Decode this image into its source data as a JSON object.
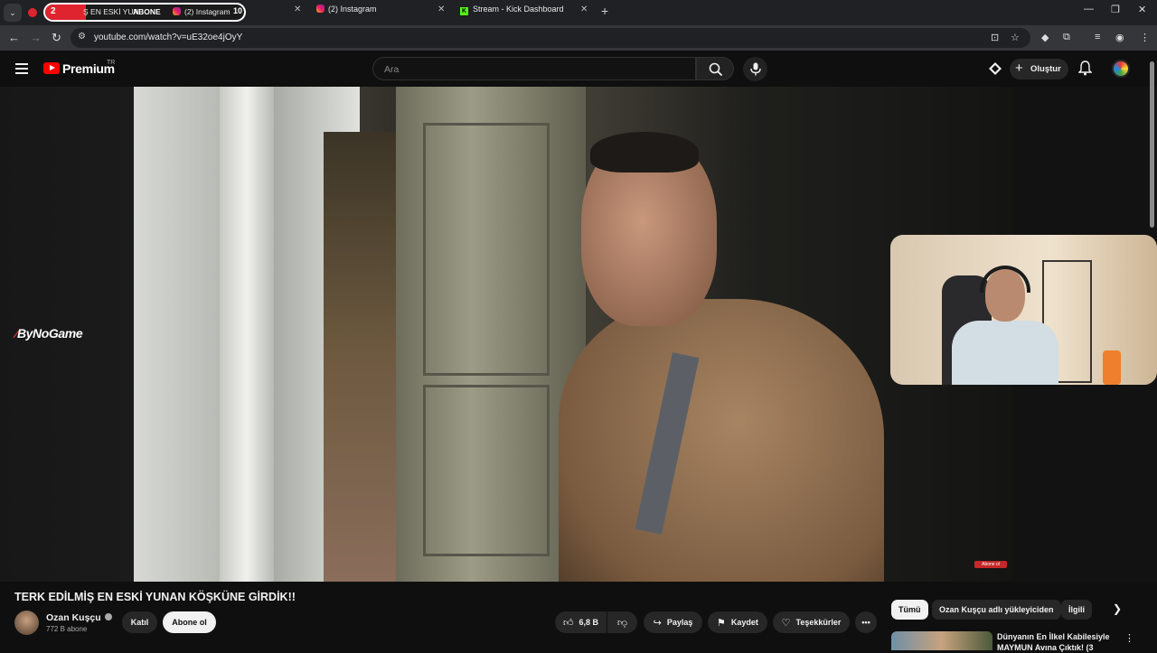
{
  "browser": {
    "tab_group_count": "2",
    "tab_group_title": "Ş EN ESKİ YUN",
    "tab_group_label": "ABONE",
    "tab_group_inst": "(2) Instagram",
    "tab_group_badge": "10",
    "tabs": [
      {
        "title": "(2) Instagram",
        "icon": "instagram-icon"
      },
      {
        "title": "Stream - Kick Dashboard",
        "icon": "kick-icon"
      }
    ],
    "url": "youtube.com/watch?v=uE32oe4jOyY"
  },
  "masthead": {
    "brand": "Premium",
    "country": "TR",
    "search_placeholder": "Ara",
    "create_label": "Oluştur"
  },
  "player": {
    "watermark": "ByNoGame",
    "endcard": "Abone ol"
  },
  "video": {
    "title": "TERK EDİLMİŞ EN ESKİ YUNAN KÖŞKÜNE GİRDİK!!",
    "channel": "Ozan Kuşçu",
    "subscribers": "772 B abone",
    "join_label": "Katıl",
    "subscribe_label": "Abone ol",
    "likes": "6,8 B",
    "share_label": "Paylaş",
    "save_label": "Kaydet",
    "thanks_label": "Teşekkürler"
  },
  "sidebar": {
    "chips": [
      "Tümü",
      "Ozan Kuşçu adlı yükleyiciden",
      "İlgili"
    ],
    "next_title": "Dünyanın En İlkel Kabilesiyle MAYMUN Avına Çıktık! (3"
  },
  "colors": {
    "brand_red": "#ff0000",
    "background": "#0f0f0f",
    "chip_active": "#f1f1f1"
  }
}
